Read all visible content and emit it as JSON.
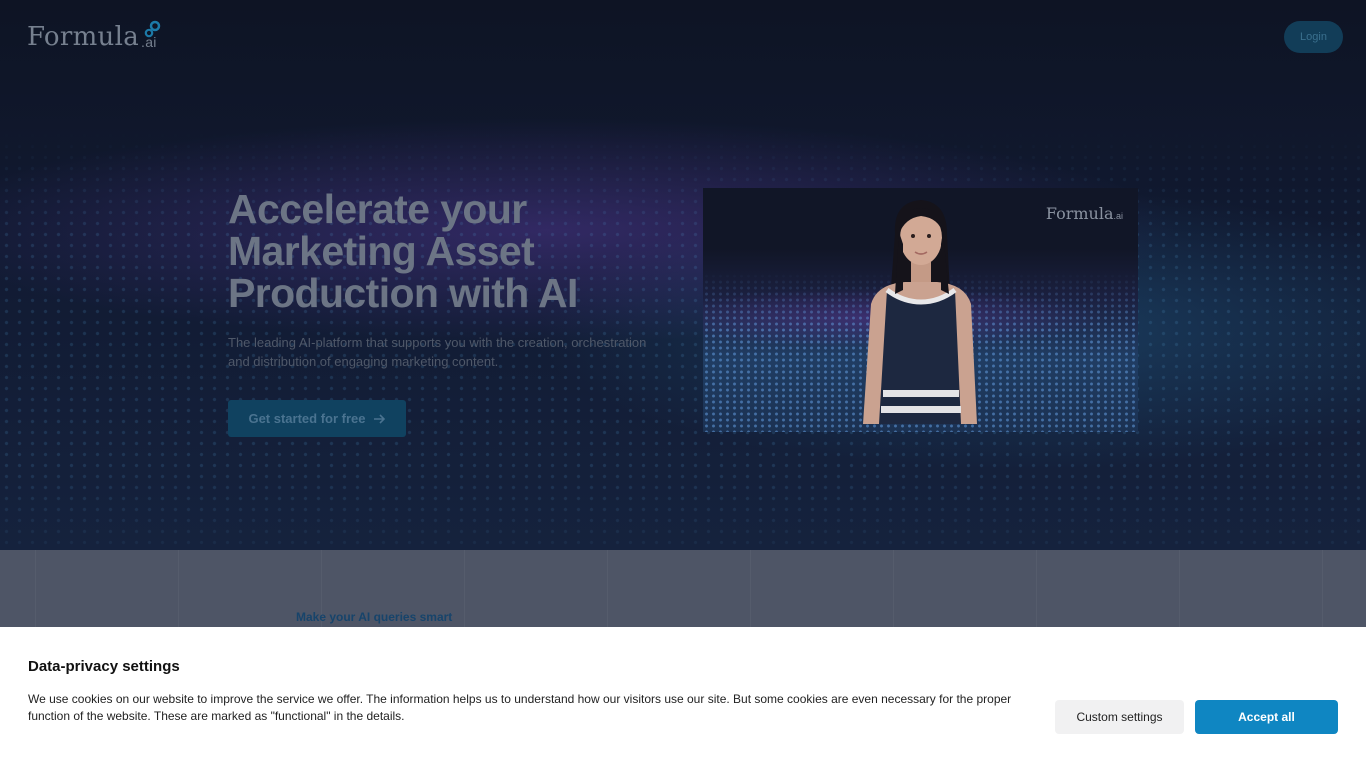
{
  "header": {
    "logo_text": "Formula",
    "logo_suffix": ".ai",
    "login_label": "Login"
  },
  "hero": {
    "headline": "Accelerate your Marketing Asset Production with AI",
    "subline": "The leading AI-platform that supports you with the creation, orchestration and distribution of engaging marketing content.",
    "cta_label": "Get started for free",
    "cta_icon": "arrow-right-icon",
    "video_logo_text": "Formula",
    "video_logo_suffix": ".ai"
  },
  "section2": {
    "kicker": "Make your AI queries smart"
  },
  "cookie_banner": {
    "title": "Data-privacy settings",
    "text": "We use cookies on our website to improve the service we offer. The information helps us to understand how our visitors use our site. But some cookies are even necessary for the proper function of the website. These are marked as \"functional\" in the details.",
    "custom_label": "Custom settings",
    "accept_label": "Accept all"
  },
  "colors": {
    "accent": "#0f86c2",
    "hero_bg": "#111a32",
    "overlay_section": "#4e5566"
  }
}
